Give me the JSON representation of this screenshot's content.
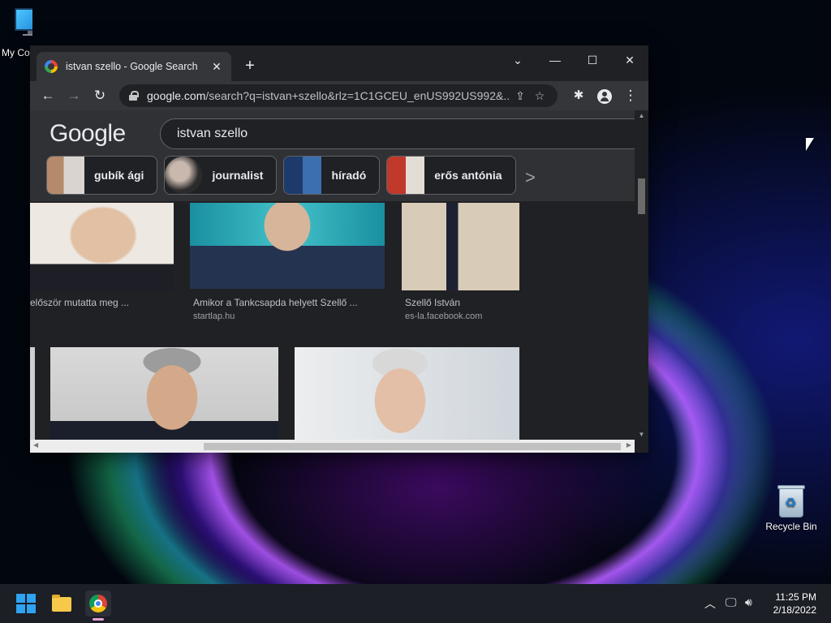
{
  "desktop": {
    "icons": [
      {
        "label": "My Co",
        "icon": "computer-icon"
      },
      {
        "label": "Recycle Bin",
        "icon": "recycle-bin-icon"
      }
    ]
  },
  "browser": {
    "tab_title": "istvan szello - Google Search",
    "new_tab_label": "+",
    "window_controls": {
      "dropdown": "⌄",
      "minimize": "—",
      "maximize": "☐",
      "close": "✕"
    },
    "nav": {
      "back": "←",
      "forward": "→",
      "reload": "↻"
    },
    "url_host": "google.com",
    "url_rest": "/search?q=istvan+szello&rlz=1C1GCEU_enUS992US992&...",
    "page": {
      "logo": "Google",
      "search_value": "istvan szello",
      "chips": [
        {
          "label": "gubík ági"
        },
        {
          "label": "journalist"
        },
        {
          "label": "híradó"
        },
        {
          "label": "erős antónia"
        }
      ],
      "results": [
        {
          "caption": "először mutatta meg ...",
          "source": ""
        },
        {
          "caption": "Amikor a Tankcsapda helyett Szellő ...",
          "source": "startlap.hu"
        },
        {
          "caption": "Szellő István",
          "source": "es-la.facebook.com"
        }
      ]
    }
  },
  "taskbar": {
    "time": "11:25 PM",
    "date": "2/18/2022",
    "apps": [
      "start-icon",
      "file-explorer-icon",
      "chrome-icon"
    ]
  },
  "colors": {
    "chrome_dark": "#202124",
    "toolbar": "#35363a",
    "taskbar": "#1c1f26",
    "accent_blue": "#2ea3f2"
  }
}
